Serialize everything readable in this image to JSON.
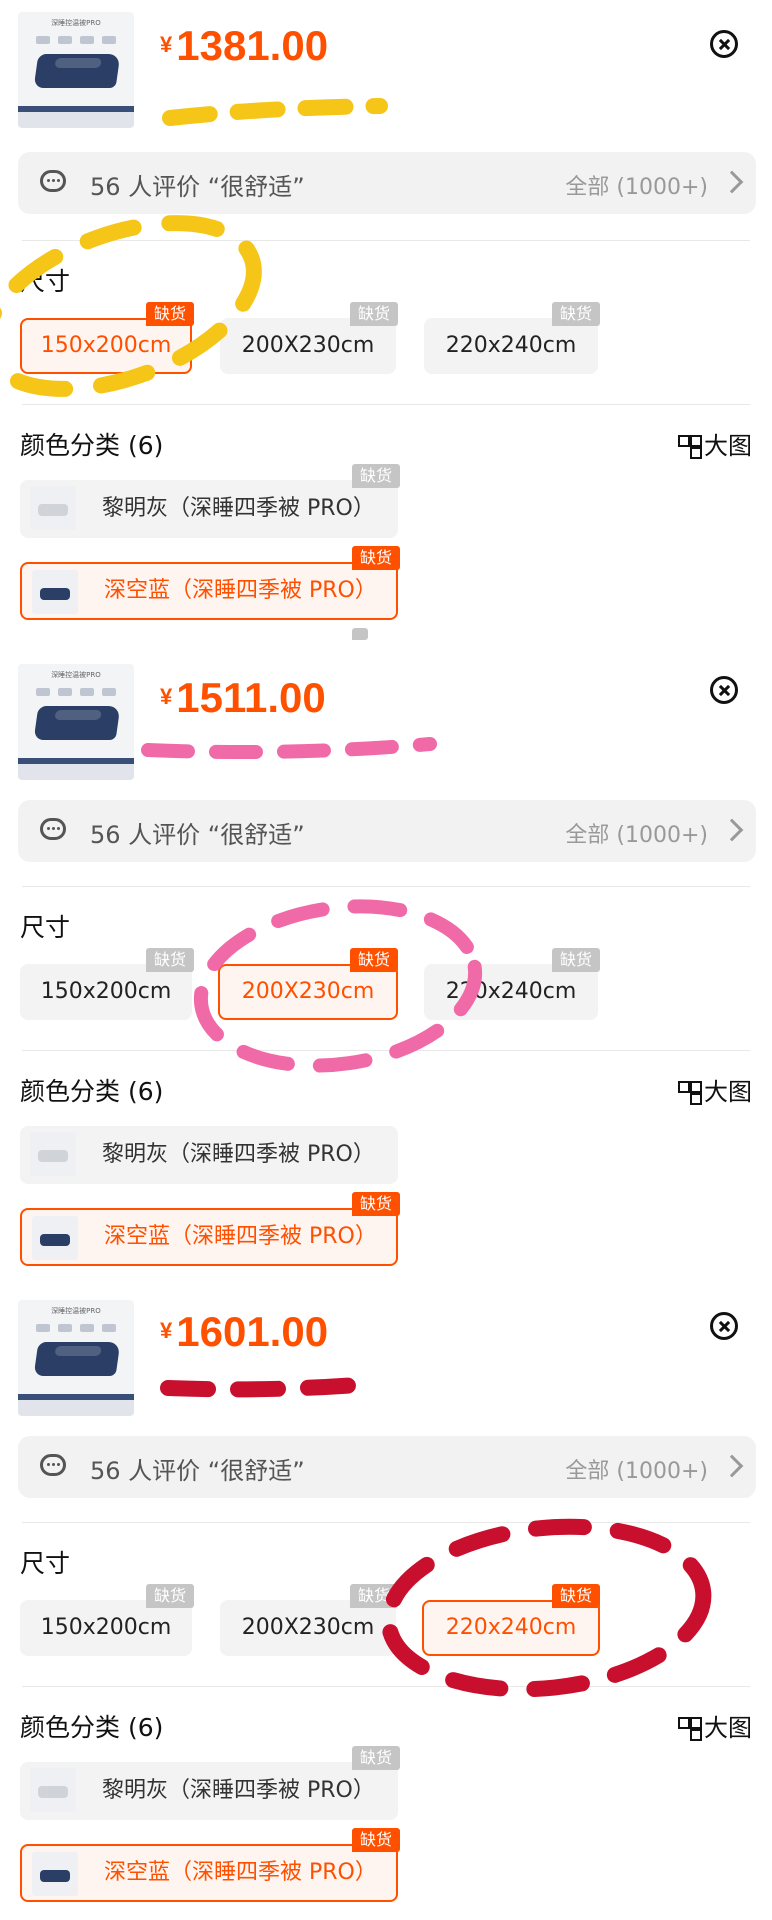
{
  "panels": [
    {
      "price_symbol": "¥",
      "price": "1381.00",
      "thumb_title": "深睡控温被PRO",
      "review_text": "56 人评价 “很舒适”",
      "review_all": "全部 (1000+)",
      "size_title": "尺寸",
      "sizes": [
        {
          "label": "150x200cm",
          "tag": "缺货",
          "selected": true
        },
        {
          "label": "200X230cm",
          "tag": "缺货",
          "selected": false
        },
        {
          "label": "220x240cm",
          "tag": "缺货",
          "selected": false
        }
      ],
      "color_title": "颜色分类 (6)",
      "big_image": "大图",
      "colors": [
        {
          "label": "黎明灰（深睡四季被 PRO）",
          "tag": "缺货",
          "selected": false
        },
        {
          "label": "深空蓝（深睡四季被 PRO）",
          "tag": "缺货",
          "selected": true
        }
      ],
      "annotation_color": "#f5c518"
    },
    {
      "price_symbol": "¥",
      "price": "1511.00",
      "thumb_title": "深睡控温被PRO",
      "review_text": "56 人评价 “很舒适”",
      "review_all": "全部 (1000+)",
      "size_title": "尺寸",
      "sizes": [
        {
          "label": "150x200cm",
          "tag": "缺货",
          "selected": false
        },
        {
          "label": "200X230cm",
          "tag": "缺货",
          "selected": true
        },
        {
          "label": "220x240cm",
          "tag": "缺货",
          "selected": false
        }
      ],
      "color_title": "颜色分类 (6)",
      "big_image": "大图",
      "colors": [
        {
          "label": "黎明灰（深睡四季被 PRO）",
          "tag": "",
          "selected": false
        },
        {
          "label": "深空蓝（深睡四季被 PRO）",
          "tag": "缺货",
          "selected": true
        }
      ],
      "annotation_color": "#f06aa8"
    },
    {
      "price_symbol": "¥",
      "price": "1601.00",
      "thumb_title": "深睡控温被PRO",
      "review_text": "56 人评价 “很舒适”",
      "review_all": "全部 (1000+)",
      "size_title": "尺寸",
      "sizes": [
        {
          "label": "150x200cm",
          "tag": "缺货",
          "selected": false
        },
        {
          "label": "200X230cm",
          "tag": "缺货",
          "selected": false
        },
        {
          "label": "220x240cm",
          "tag": "缺货",
          "selected": true
        }
      ],
      "color_title": "颜色分类 (6)",
      "big_image": "大图",
      "colors": [
        {
          "label": "黎明灰（深睡四季被 PRO）",
          "tag": "缺货",
          "selected": false
        },
        {
          "label": "深空蓝（深睡四季被 PRO）",
          "tag": "缺货",
          "selected": true
        }
      ],
      "annotation_color": "#c8102e"
    }
  ],
  "colors": {
    "accent": "#ff5000",
    "tag_gray": "#c5c5c5",
    "background": "#ffffff"
  }
}
